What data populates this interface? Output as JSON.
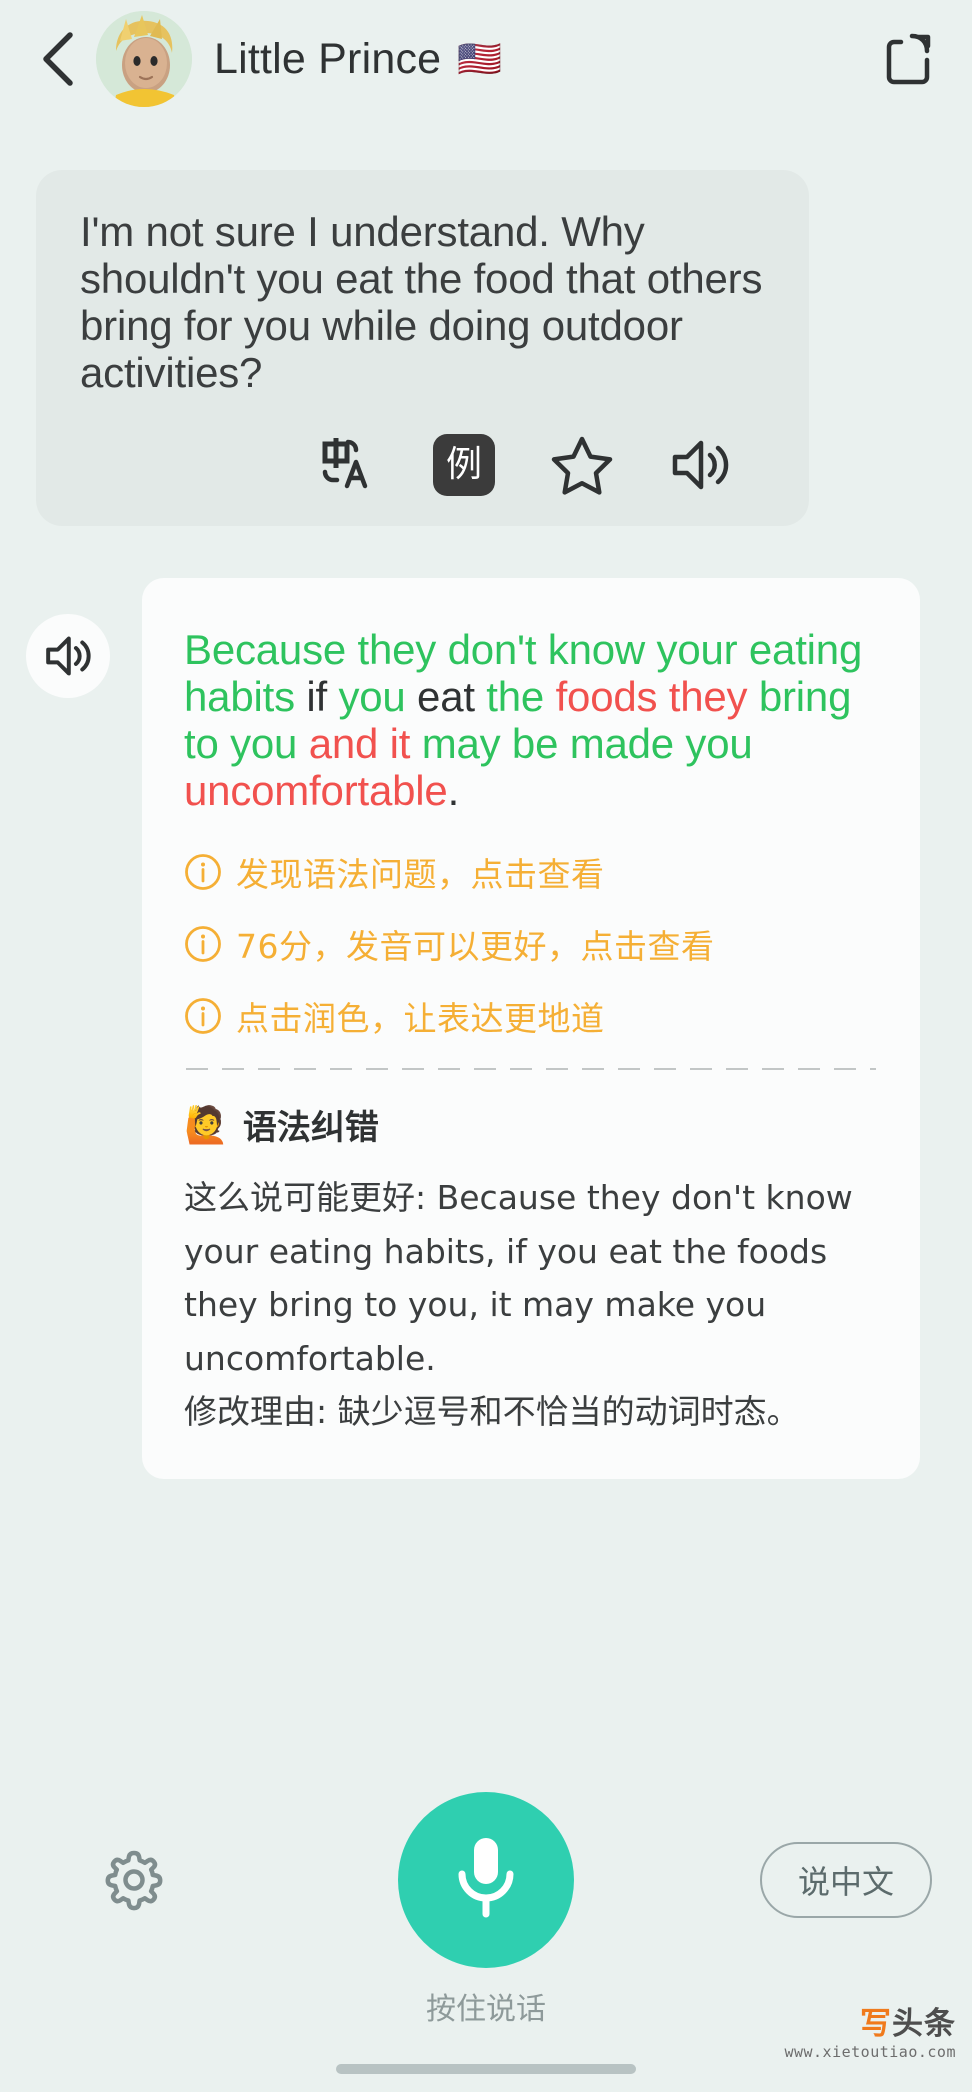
{
  "header": {
    "back_icon": "chevron-left-icon",
    "title": "Little Prince",
    "flag": "🇺🇸",
    "share_icon": "share-icon"
  },
  "messages": {
    "incoming": {
      "text": "I'm not sure I understand. Why shouldn't you eat the food that others bring for you while doing outdoor activities?",
      "actions": [
        {
          "name": "translate-icon",
          "label": "中A"
        },
        {
          "name": "example-button",
          "label": "例"
        },
        {
          "name": "star-icon",
          "label": "★"
        },
        {
          "name": "speaker-icon",
          "label": "🔊"
        }
      ]
    },
    "outgoing": {
      "speaker_icon": "speaker-icon",
      "answer_tokens": [
        {
          "t": "Because they don't know your eating habits ",
          "c": "g"
        },
        {
          "t": "if ",
          "c": "n"
        },
        {
          "t": "you ",
          "c": "g"
        },
        {
          "t": "eat ",
          "c": "n"
        },
        {
          "t": "the ",
          "c": "g"
        },
        {
          "t": "foods they ",
          "c": "r"
        },
        {
          "t": "bring to you ",
          "c": "g"
        },
        {
          "t": "and it ",
          "c": "r"
        },
        {
          "t": "may be made you ",
          "c": "g"
        },
        {
          "t": "uncomfortable",
          "c": "r"
        },
        {
          "t": ".",
          "c": "n"
        }
      ],
      "answer_plain": "Because they don't know your eating habits if you eat the foods they bring to you and it may be made you uncomfortable.",
      "hints": [
        "发现语法问题，点击查看",
        "76分，发音可以更好，点击查看",
        "点击润色，让表达更地道"
      ],
      "grammar": {
        "emoji": "🙋",
        "title": "语法纠错",
        "suggestion": "这么说可能更好: Because they don't know your eating habits, if you eat the foods they bring to you, it may make you uncomfortable.",
        "reason": "修改理由: 缺少逗号和不恰当的动词时态。"
      }
    }
  },
  "bottom": {
    "gear_icon": "gear-icon",
    "mic_icon": "microphone-icon",
    "mic_label": "按住说话",
    "lang_label": "说中文"
  },
  "watermark": {
    "brand_c1": "写",
    "brand_c2": "头条",
    "url": "www.xietoutiao.com"
  },
  "colors": {
    "page_bg": "#eaf1ef",
    "bubble_in_bg": "#e2e9e7",
    "card_bg": "#fbfcfc",
    "green": "#2ec35e",
    "red": "#f1514e",
    "orange": "#f5af35",
    "mic_teal": "#2fcfb0"
  }
}
